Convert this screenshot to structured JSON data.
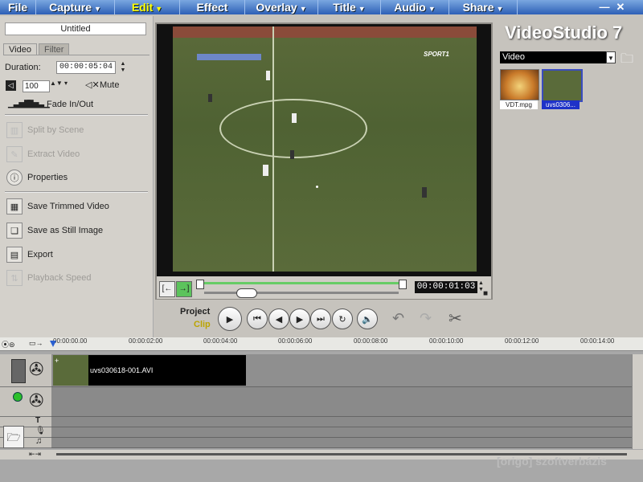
{
  "menu": {
    "file": "File",
    "items": [
      {
        "label": "Capture"
      },
      {
        "label": "Edit"
      },
      {
        "label": "Effect"
      },
      {
        "label": "Overlay"
      },
      {
        "label": "Title"
      },
      {
        "label": "Audio"
      },
      {
        "label": "Share"
      }
    ]
  },
  "left": {
    "title_value": "Untitled",
    "tabs": [
      "Video",
      "Filter"
    ],
    "duration_label": "Duration:",
    "duration_value": "00:00:05:04",
    "volume_value": "100",
    "mute_label": "Mute",
    "fade_label": "Fade In/Out",
    "actions": [
      {
        "label": "Split by Scene"
      },
      {
        "label": "Extract Video"
      },
      {
        "label": "Properties"
      },
      {
        "label": "Save Trimmed Video"
      },
      {
        "label": "Save as Still Image"
      },
      {
        "label": "Export"
      },
      {
        "label": "Playback Speed"
      }
    ]
  },
  "preview": {
    "timecode": "00:00:01:03",
    "overlay_text": "SPORT1",
    "mode_project": "Project",
    "mode_clip": "Clip"
  },
  "library": {
    "logo": "VideoStudio 7",
    "category": "Video",
    "thumbs": [
      {
        "label": "VDT.mpg"
      },
      {
        "label": "uvs0306..."
      }
    ]
  },
  "timeline": {
    "ticks": [
      "00:00:00.00",
      "00:00:02:00",
      "00:00:04:00",
      "00:00:06:00",
      "00:00:08:00",
      "00:00:10:00",
      "00:00:12:00",
      "00:00:14:00"
    ],
    "clip_label": "uvs030618-001.AVI"
  },
  "watermark": "[origo] szoftverbázis"
}
